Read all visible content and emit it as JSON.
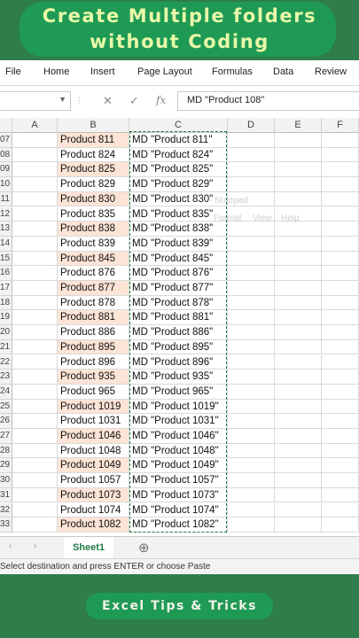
{
  "banner": {
    "line1": "Create Multiple folders",
    "line2": "without Coding"
  },
  "menu": [
    "File",
    "Home",
    "Insert",
    "Page Layout",
    "Formulas",
    "Data",
    "Review"
  ],
  "formula_bar": {
    "cancel_icon": "✕",
    "enter_icon": "✓",
    "fx_icon": "fx",
    "formula": "MD \"Product 108\""
  },
  "columns": [
    "A",
    "B",
    "C",
    "D",
    "E",
    "F"
  ],
  "rows": [
    {
      "num": "07",
      "b": "Product 811",
      "c": "MD \"Product 811\"",
      "shade": true
    },
    {
      "num": "08",
      "b": "Product 824",
      "c": "MD \"Product 824\"",
      "shade": false
    },
    {
      "num": "09",
      "b": "Product 825",
      "c": "MD \"Product 825\"",
      "shade": true
    },
    {
      "num": "10",
      "b": "Product 829",
      "c": "MD \"Product 829\"",
      "shade": false
    },
    {
      "num": "11",
      "b": "Product 830",
      "c": "MD \"Product 830\"",
      "shade": true
    },
    {
      "num": "12",
      "b": "Product 835",
      "c": "MD \"Product 835\"",
      "shade": false
    },
    {
      "num": "13",
      "b": "Product 838",
      "c": "MD \"Product 838\"",
      "shade": true
    },
    {
      "num": "14",
      "b": "Product 839",
      "c": "MD \"Product 839\"",
      "shade": false
    },
    {
      "num": "15",
      "b": "Product 845",
      "c": "MD \"Product 845\"",
      "shade": true
    },
    {
      "num": "16",
      "b": "Product 876",
      "c": "MD \"Product 876\"",
      "shade": false
    },
    {
      "num": "17",
      "b": "Product 877",
      "c": "MD \"Product 877\"",
      "shade": true
    },
    {
      "num": "18",
      "b": "Product 878",
      "c": "MD \"Product 878\"",
      "shade": false
    },
    {
      "num": "19",
      "b": "Product 881",
      "c": "MD \"Product 881\"",
      "shade": true
    },
    {
      "num": "20",
      "b": "Product 886",
      "c": "MD \"Product 886\"",
      "shade": false
    },
    {
      "num": "21",
      "b": "Product 895",
      "c": "MD \"Product 895\"",
      "shade": true
    },
    {
      "num": "22",
      "b": "Product 896",
      "c": "MD \"Product 896\"",
      "shade": false
    },
    {
      "num": "23",
      "b": "Product 935",
      "c": "MD \"Product 935\"",
      "shade": true
    },
    {
      "num": "24",
      "b": "Product 965",
      "c": "MD \"Product 965\"",
      "shade": false
    },
    {
      "num": "25",
      "b": "Product 1019",
      "c": "MD \"Product 1019\"",
      "shade": true
    },
    {
      "num": "26",
      "b": "Product 1031",
      "c": "MD \"Product 1031\"",
      "shade": false
    },
    {
      "num": "27",
      "b": "Product 1046",
      "c": "MD \"Product 1046\"",
      "shade": true
    },
    {
      "num": "28",
      "b": "Product 1048",
      "c": "MD \"Product 1048\"",
      "shade": false
    },
    {
      "num": "29",
      "b": "Product 1049",
      "c": "MD \"Product 1049\"",
      "shade": true
    },
    {
      "num": "30",
      "b": "Product 1057",
      "c": "MD \"Product 1057\"",
      "shade": false
    },
    {
      "num": "31",
      "b": "Product 1073",
      "c": "MD \"Product 1073\"",
      "shade": true
    },
    {
      "num": "32",
      "b": "Product 1074",
      "c": "MD \"Product 1074\"",
      "shade": false
    },
    {
      "num": "33",
      "b": "Product 1082",
      "c": "MD \"Product 1082\"",
      "shade": true
    }
  ],
  "ghost_notepad": {
    "title": "- Notepad",
    "menu": [
      "Format",
      "View",
      "Help"
    ]
  },
  "sheet_tab": "Sheet1",
  "add_sheet_icon": "⊕",
  "status": "Select destination and press ENTER or choose Paste",
  "footer": "Excel Tips & Tricks",
  "colors": {
    "banner_bg": "#2e7d4a",
    "pill_bg": "#1f9a55",
    "title_text": "#e8f8a8",
    "shaded_cell": "#fce4d6",
    "accent": "#1f7a45"
  }
}
